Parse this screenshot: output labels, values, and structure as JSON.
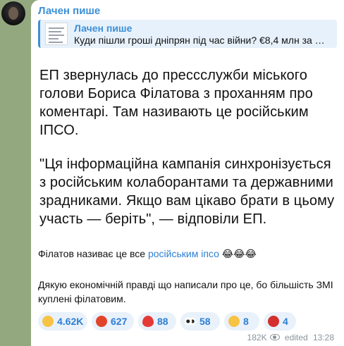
{
  "message": {
    "author": "Лачен пише",
    "reply": {
      "author": "Лачен пише",
      "text": "Куди пішли гроші дніпрян під час війни? €8,4 млн за в..."
    },
    "paragraph1": "ЕП звернулась до пресcслужби міського голови Бориса Філатова з проханням про коментарі. Там називають це російським ІПСО.",
    "paragraph2": "\"Ця інформаційна кампанія синхронізується з російським колаборантами та державними зрадниками. Якщо вам цікаво брати в цьому участь — беріть\", — відповіли ЕП.",
    "comment1_prefix": "Філатов називає це все ",
    "comment1_link": "російським іпсо",
    "comment1_emojis": "😂😂😂",
    "comment2": "Дякую економічній правді що написали про це, бо більшість ЗМІ куплені філатовим.",
    "reactions": [
      {
        "icon": "grinning-face-icon",
        "emoji": "😁",
        "count": "4.62K",
        "color": "#f6c344"
      },
      {
        "icon": "angry-face-icon",
        "emoji": "🤬",
        "count": "627",
        "color": "#e0452b"
      },
      {
        "icon": "heart-icon",
        "emoji": "❤",
        "count": "88",
        "color": "#e53935"
      },
      {
        "icon": "eyes-icon",
        "emoji": "👀",
        "count": "58",
        "color": "#ffffff"
      },
      {
        "icon": "shush-face-icon",
        "emoji": "🤫",
        "count": "8",
        "color": "#f6c344"
      },
      {
        "icon": "broken-heart-icon",
        "emoji": "💔",
        "count": "4",
        "color": "#d32f2f"
      }
    ],
    "views": "182K",
    "edited": "edited",
    "time": "13:28"
  }
}
